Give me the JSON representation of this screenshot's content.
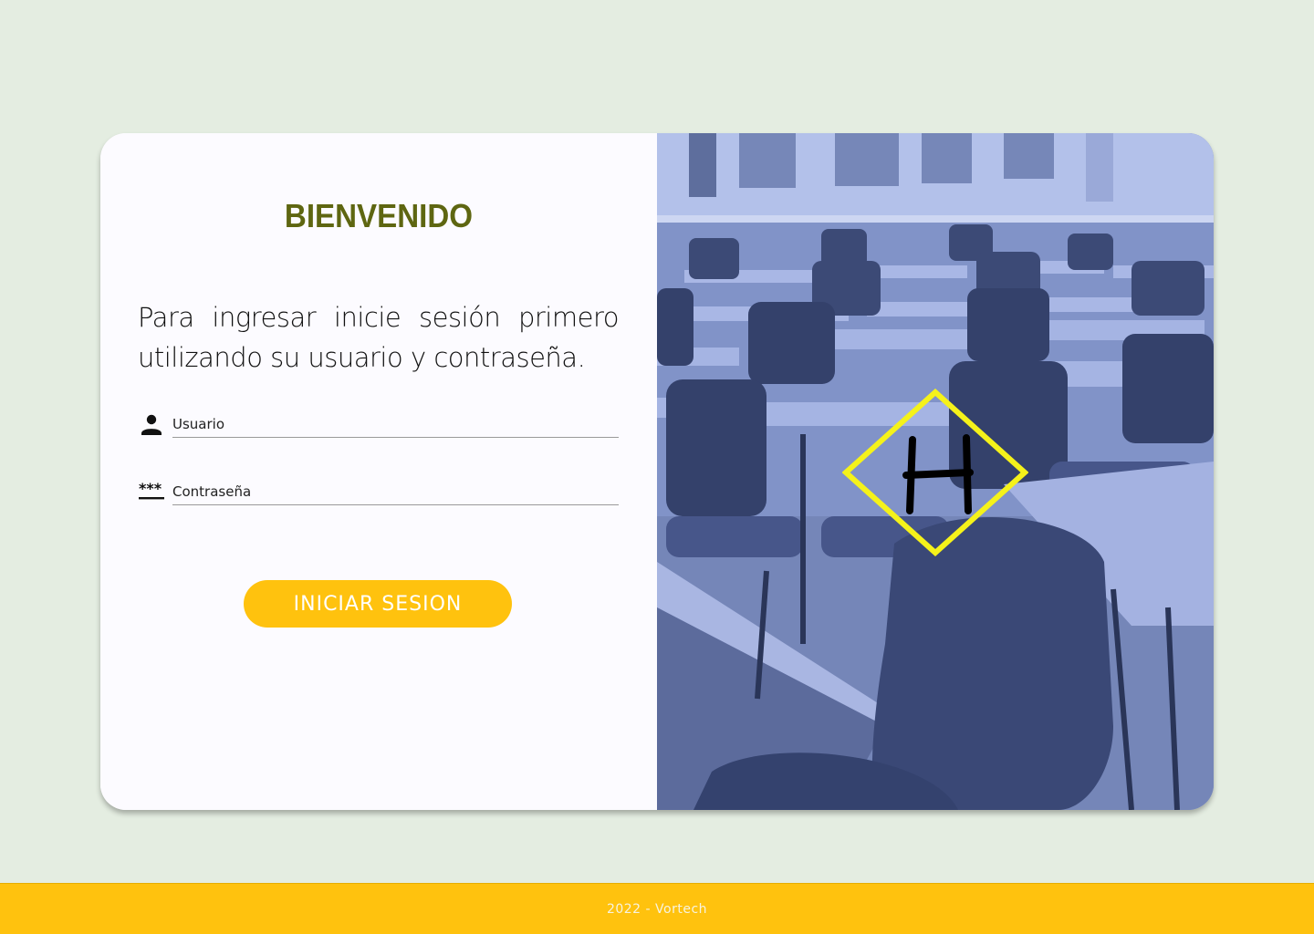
{
  "login": {
    "title": "BIENVENIDO",
    "intro": "Para ingresar inicie sesión primero utilizando su usuario y contraseña.",
    "username": {
      "placeholder": "Usuario",
      "icon": "person-icon"
    },
    "password": {
      "placeholder": "Contraseña",
      "icon": "password-icon"
    },
    "submit_label": "INICIAR SESION"
  },
  "hero": {
    "image": "classroom-photo",
    "logo_letter": "H",
    "logo_color": "#f5f21a"
  },
  "footer": {
    "text": "2022 - Vortech"
  },
  "colors": {
    "background": "#e4ede1",
    "title": "#5e6611",
    "accent": "#ffc20e",
    "image_tint": "#7f93c7"
  }
}
